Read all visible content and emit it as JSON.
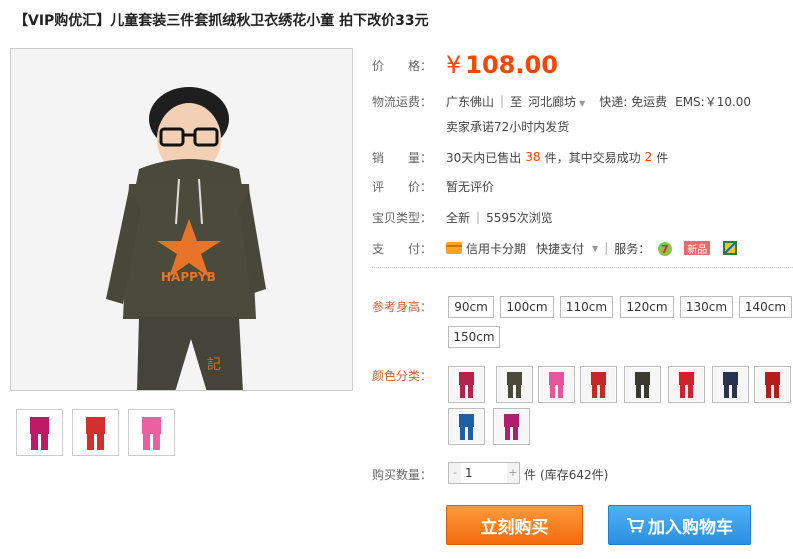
{
  "title": "【VIP购优汇】儿童套装三件套抓绒秋卫衣绣花小童 拍下改价33元",
  "price": {
    "label": "价　　格：",
    "currency": "¥",
    "value": "108.00"
  },
  "shipping": {
    "label": "物流运费：",
    "from": "广东佛山",
    "to_word": "至",
    "to": "河北廊坊",
    "express": "快递: 免运费",
    "ems": "EMS:￥10.00",
    "promise": "卖家承诺72小时内发货"
  },
  "sales": {
    "label": "销　　量：",
    "prefix": "30天内已售出",
    "sold": "38",
    "mid": "件，其中交易成功",
    "success": "2",
    "suffix": "件"
  },
  "review": {
    "label": "评　　价：",
    "value": "暂无评价"
  },
  "item_type": {
    "label": "宝贝类型：",
    "condition": "全新",
    "views": "5595次浏览"
  },
  "payment": {
    "label": "支　　付：",
    "credit": "信用卡分期",
    "quick": "快捷支付",
    "service_label": "服务：",
    "badge_new": "新品"
  },
  "height": {
    "label": "参考身高：",
    "options": [
      "90cm",
      "100cm",
      "110cm",
      "120cm",
      "130cm",
      "140cm",
      "150cm"
    ]
  },
  "color": {
    "label": "颜色分类：",
    "swatches": [
      "#b4234a",
      "#4a4a3a",
      "#e8559a",
      "#c62828",
      "#3a3a30",
      "#d3202a",
      "#2a3150",
      "#b71c1c",
      "#1f5fa8",
      "#b0206a"
    ]
  },
  "quantity": {
    "label": "购买数量：",
    "minus": "-",
    "value": "1",
    "plus": "+",
    "unit": "件",
    "stock": "(库存642件)"
  },
  "actions": {
    "buy": "立刻购买",
    "cart": "加入购物车"
  },
  "thumbs": [
    "#c2186a",
    "#d32f2f",
    "#ec5fa0"
  ]
}
